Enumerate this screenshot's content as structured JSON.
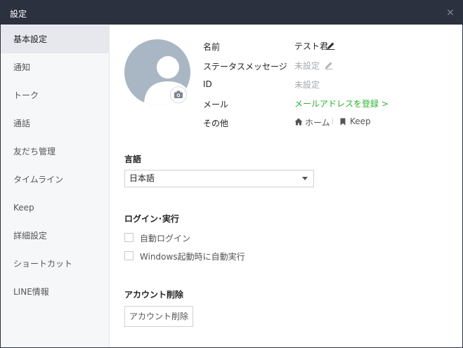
{
  "window": {
    "title": "設定",
    "close_glyph": "×"
  },
  "sidebar": {
    "items": [
      {
        "label": "基本設定",
        "active": true
      },
      {
        "label": "通知"
      },
      {
        "label": "トーク"
      },
      {
        "label": "通話"
      },
      {
        "label": "友だち管理"
      },
      {
        "label": "タイムライン"
      },
      {
        "label": "Keep"
      },
      {
        "label": "詳細設定"
      },
      {
        "label": "ショートカット"
      },
      {
        "label": "LINE情報"
      }
    ]
  },
  "profile": {
    "name_label": "名前",
    "name_value": "テスト君",
    "status_label": "ステータスメッセージ",
    "status_value": "未設定",
    "id_label": "ID",
    "id_value": "未設定",
    "mail_label": "メール",
    "mail_link": "メールアドレスを登録 >",
    "other_label": "その他",
    "home_link": "ホーム",
    "keep_link": "Keep"
  },
  "language": {
    "title": "言語",
    "selected": "日本語"
  },
  "login": {
    "title": "ログイン･実行",
    "auto_login": "自動ログイン",
    "auto_start": "Windows起動時に自動実行"
  },
  "account": {
    "title": "アカウント削除",
    "button": "アカウント削除"
  },
  "colors": {
    "titlebar": "#2c3140",
    "sidebar_bg": "#f6f7f9",
    "active_item": "#e6e8ee",
    "link_green": "#2cb12e",
    "avatar_bg": "#a9b6c4"
  }
}
